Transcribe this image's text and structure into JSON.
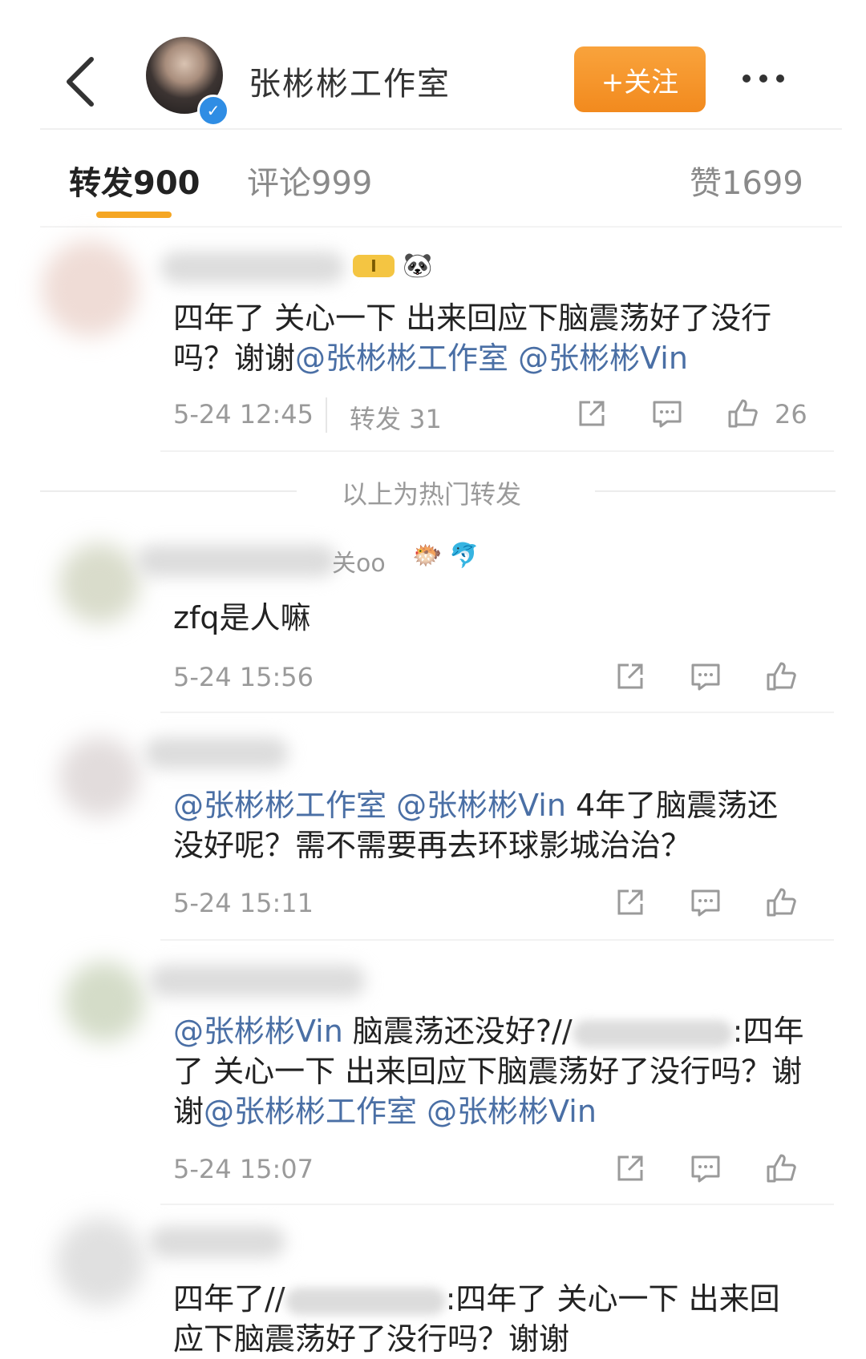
{
  "header": {
    "account_name": "张彬彬工作室",
    "follow_label": "+关注",
    "verified_mark": "✓"
  },
  "tabs": [
    {
      "label": "转发900"
    },
    {
      "label": "评论999"
    },
    {
      "label": "赞1699"
    }
  ],
  "hot_separator": "以上为热门转发",
  "comments": [
    {
      "badges": [
        "I",
        "🐼"
      ],
      "text_parts": [
        "四年了 关心一下 出来回应下脑震荡好了没行吗？谢谢",
        "@张彬彬工作室",
        " ",
        "@张彬彬Vin"
      ],
      "time": "5-24 12:45",
      "reposts": "转发 31",
      "likes": "26"
    },
    {
      "name_fragment": "关oo",
      "badges": [
        "🐡",
        "🐬"
      ],
      "text_parts": [
        "zfq是人嘛"
      ],
      "time": "5-24 15:56"
    },
    {
      "text_parts": [
        "@张彬彬工作室",
        " ",
        "@张彬彬Vin",
        " 4年了脑震荡还没好呢？需不需要再去环球影城治治？"
      ],
      "time": "5-24 15:11"
    },
    {
      "text_parts": [
        "@张彬彬Vin",
        " 脑震荡还没好?//",
        ":四年了 关心一下 出来回应下脑震荡好了没行吗？谢谢",
        "@张彬彬工作室",
        " ",
        "@张彬彬Vin"
      ],
      "time": "5-24 15:07"
    },
    {
      "text_parts": [
        "四年了//",
        ":四年了 关心一下 出来回应下脑震荡好了没行吗？谢谢"
      ]
    }
  ],
  "colors": {
    "accent": "#f5a623",
    "follow_button": "#f28a1e",
    "mention": "#4a6fa5",
    "muted_text": "#9a9a9a",
    "verified": "#2f8de4"
  },
  "icons": [
    "back-arrow-icon",
    "more-dots-icon",
    "share-icon",
    "comment-icon",
    "like-icon"
  ]
}
